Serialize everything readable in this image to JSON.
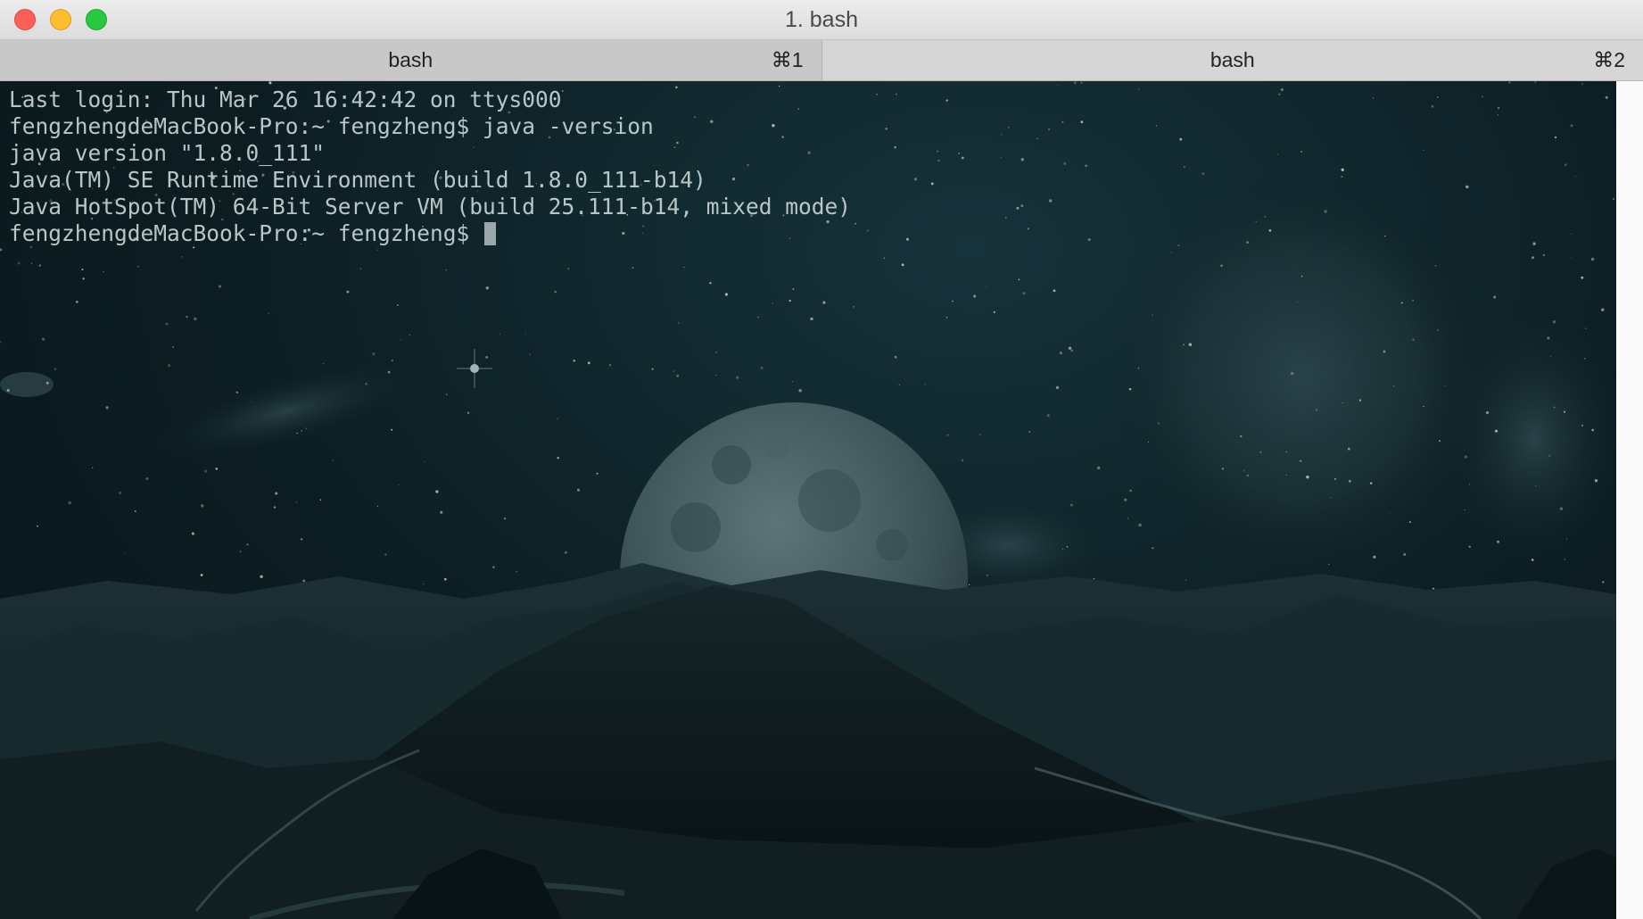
{
  "window": {
    "title": "1. bash",
    "controls": [
      "close-button",
      "minimize-button",
      "zoom-button"
    ]
  },
  "tabs": [
    {
      "label": "bash",
      "shortcut": "⌘1",
      "active": true
    },
    {
      "label": "bash",
      "shortcut": "⌘2",
      "active": false
    }
  ],
  "terminal": {
    "lines": [
      "Last login: Thu Mar 26 16:42:42 on ttys000",
      "fengzhengdeMacBook-Pro:~ fengzheng$ java -version",
      "java version \"1.8.0_111\"",
      "Java(TM) SE Runtime Environment (build 1.8.0_111-b14)",
      "Java HotSpot(TM) 64-Bit Server VM (build 25.111-b14, mixed mode)"
    ],
    "prompt": "fengzhengdeMacBook-Pro:~ fengzheng$ "
  },
  "colors": {
    "background": "#0e1f23",
    "text": "#b9c6c8",
    "close": "#fc5f57",
    "minimize": "#fdbd2e",
    "zoom": "#28c840"
  }
}
